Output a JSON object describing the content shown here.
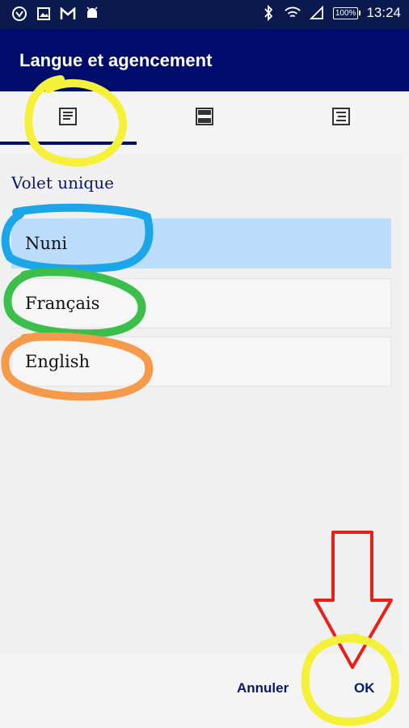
{
  "status_bar": {
    "time": "13:24",
    "battery": "100%",
    "left_icons": [
      "app-icon",
      "image-icon",
      "gmail-icon",
      "android-icon"
    ],
    "right_icons": [
      "bluetooth-icon",
      "wifi-icon",
      "signal-icon",
      "battery-icon"
    ]
  },
  "app_bar": {
    "title": "Langue et agencement"
  },
  "tabs": [
    {
      "icon": "single-pane-layout-icon",
      "selected": true
    },
    {
      "icon": "split-pane-layout-icon",
      "selected": false
    },
    {
      "icon": "list-layout-icon",
      "selected": false
    }
  ],
  "section": {
    "title": "Volet unique"
  },
  "languages": [
    {
      "label": "Nuni",
      "selected": true
    },
    {
      "label": "Français",
      "selected": false
    },
    {
      "label": "English",
      "selected": false
    }
  ],
  "buttons": {
    "cancel": "Annuler",
    "ok": "OK"
  },
  "colors": {
    "app_bar": "#000c6b",
    "selected_item": "#bbdcfb",
    "annotation_yellow": "#f5f03a",
    "annotation_blue": "#1aa6e8",
    "annotation_green": "#3bbf4a",
    "annotation_orange": "#f5994a",
    "annotation_red": "#e8201a"
  }
}
